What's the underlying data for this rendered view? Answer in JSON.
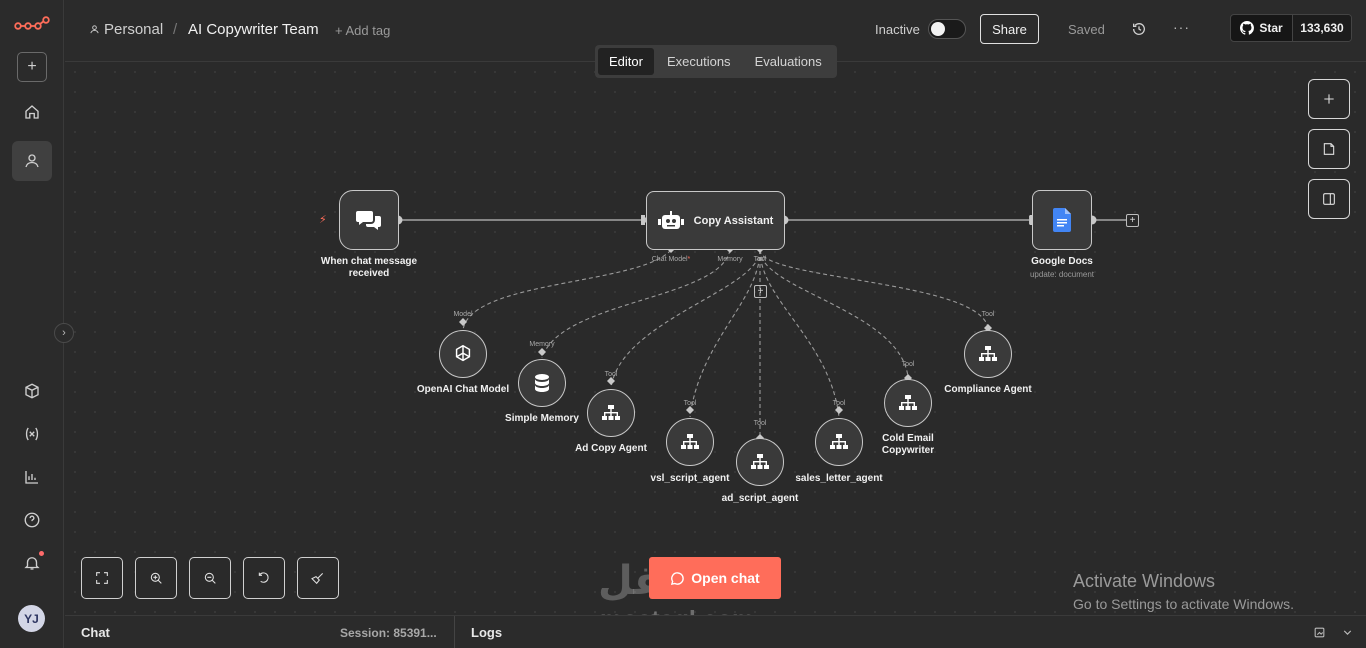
{
  "app": {
    "name": "n8n"
  },
  "sidebar": {
    "add_label": "+",
    "avatar_initials": "YJ",
    "collapse_label": "›"
  },
  "header": {
    "project": "Personal",
    "separator": "/",
    "workflow_title": "AI Copywriter Team",
    "add_tag": "+ Add tag",
    "status_label": "Inactive",
    "share_label": "Share",
    "saved_label": "Saved",
    "more_label": "···",
    "github_star": "Star",
    "github_count": "133,630"
  },
  "tabs": [
    "Editor",
    "Executions",
    "Evaluations"
  ],
  "nodes": {
    "trigger": {
      "label_line1": "When chat message",
      "label_line2": "received"
    },
    "agent": {
      "label": "Copy Assistant",
      "port_model": "Chat Model",
      "port_model_req": "*",
      "port_memory": "Memory",
      "port_tool": "Tool"
    },
    "docs": {
      "label": "Google Docs",
      "sub": "update: document"
    },
    "openai": {
      "label": "OpenAI Chat Model",
      "port": "Model"
    },
    "memory": {
      "label": "Simple Memory",
      "port": "Memory"
    },
    "ad_copy": {
      "label": "Ad Copy Agent",
      "port": "Tool"
    },
    "vsl": {
      "label": "vsl_script_agent",
      "port": "Tool"
    },
    "ad_script": {
      "label": "ad_script_agent",
      "port": "Tool"
    },
    "sales_letter": {
      "label": "sales_letter_agent",
      "port": "Tool"
    },
    "cold_email": {
      "label_line1": "Cold Email",
      "label_line2": "Copywriter",
      "port": "Tool"
    },
    "compliance": {
      "label": "Compliance Agent",
      "port": "Tool"
    }
  },
  "canvas": {
    "open_chat_label": "Open chat",
    "watermark_ar": "مستقل",
    "watermark_en": "mostaql.com",
    "activate_title": "Activate Windows",
    "activate_sub": "Go to Settings to activate Windows."
  },
  "bottom": {
    "chat_label": "Chat",
    "session_label": "Session: 85391...",
    "logs_label": "Logs"
  },
  "colors": {
    "accent": "#ff6d5a",
    "canvas": "#2a2a2a",
    "node_border": "#c8c8c8"
  }
}
